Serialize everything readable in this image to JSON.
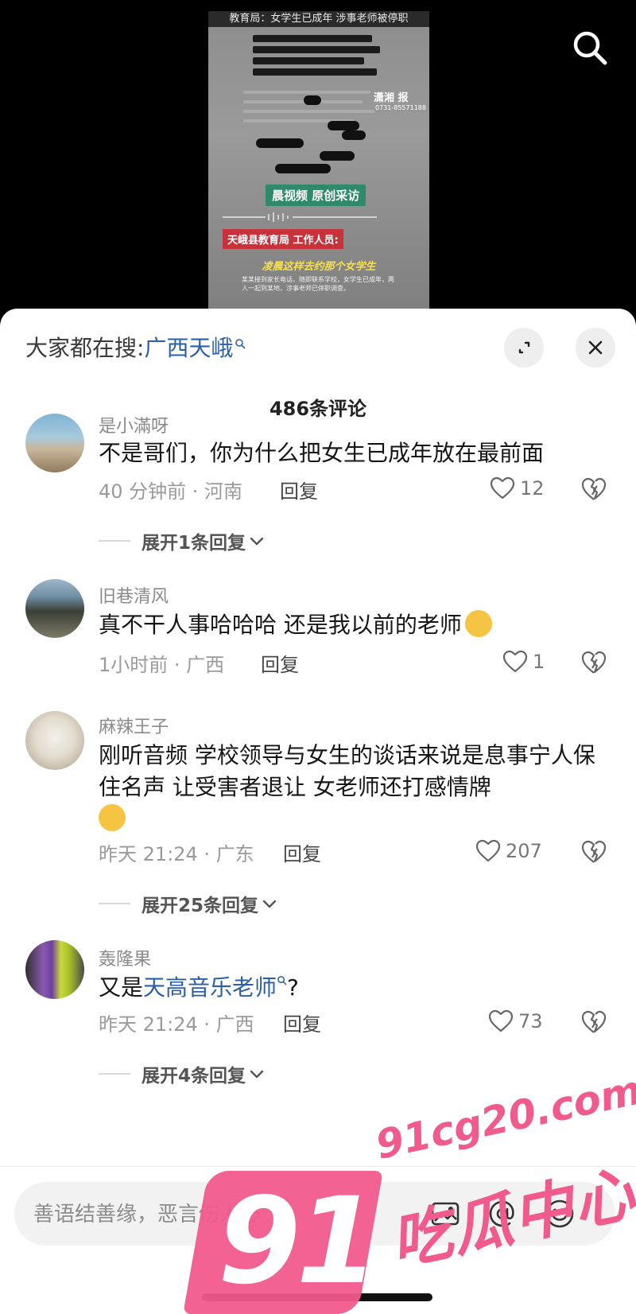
{
  "video": {
    "headline": "教育局：女学生已成年 涉事老师被停职",
    "stamp": "潇湘 报",
    "stamp_sub": "0731-85571188",
    "badge": "晨视频 原创采访",
    "speaker": "天峨县教育局 工作人员:",
    "caption": "凌晨这样去约那个女学生",
    "subtext": "某某接到家长电话，随即联系学校，女学生已成年，两人一起到某地，涉事老师已停职调查。"
  },
  "header": {
    "search_prefix": "大家都在搜:",
    "search_keyword": "广西天峨",
    "comment_count": "486条评论"
  },
  "comments": [
    {
      "user": "是小滿呀",
      "text": "不是哥们，你为什么把女生已成年放在最前面",
      "time": "40 分钟前 · 河南",
      "reply_label": "回复",
      "likes": "12",
      "expand": "展开1条回复"
    },
    {
      "user": "旧巷清风",
      "text": "真不干人事哈哈哈   还是我以前的老师",
      "time": "1小时前 · 广西",
      "reply_label": "回复",
      "likes": "1"
    },
    {
      "user": "麻辣王子",
      "text": "刚听音频   学校领导与女生的谈话来说是息事宁人保住名声 让受害者退让 女老师还打感情牌",
      "time": "昨天 21:24 · 广东",
      "reply_label": "回复",
      "likes": "207",
      "expand": "展开25条回复"
    },
    {
      "user": "轰隆果",
      "text_prefix": "又是",
      "text_link": "天高音乐老师",
      "text_suffix": "?",
      "time": "昨天 21:24 · 广西",
      "reply_label": "回复",
      "likes": "73",
      "expand": "展开4条回复"
    }
  ],
  "input": {
    "placeholder": "善语结善缘，恶言伤人心"
  },
  "watermark": {
    "logo": "91",
    "domain": "91cg20.com",
    "brand": "吃瓜中心"
  },
  "colors": {
    "link": "#2b5fa8",
    "watermark": "#f15a8c"
  },
  "icons": [
    "search-icon",
    "expand-icon",
    "close-icon",
    "heart-icon",
    "broken-heart-icon",
    "chevron-down-icon",
    "image-icon",
    "at-icon",
    "emoji-icon"
  ]
}
